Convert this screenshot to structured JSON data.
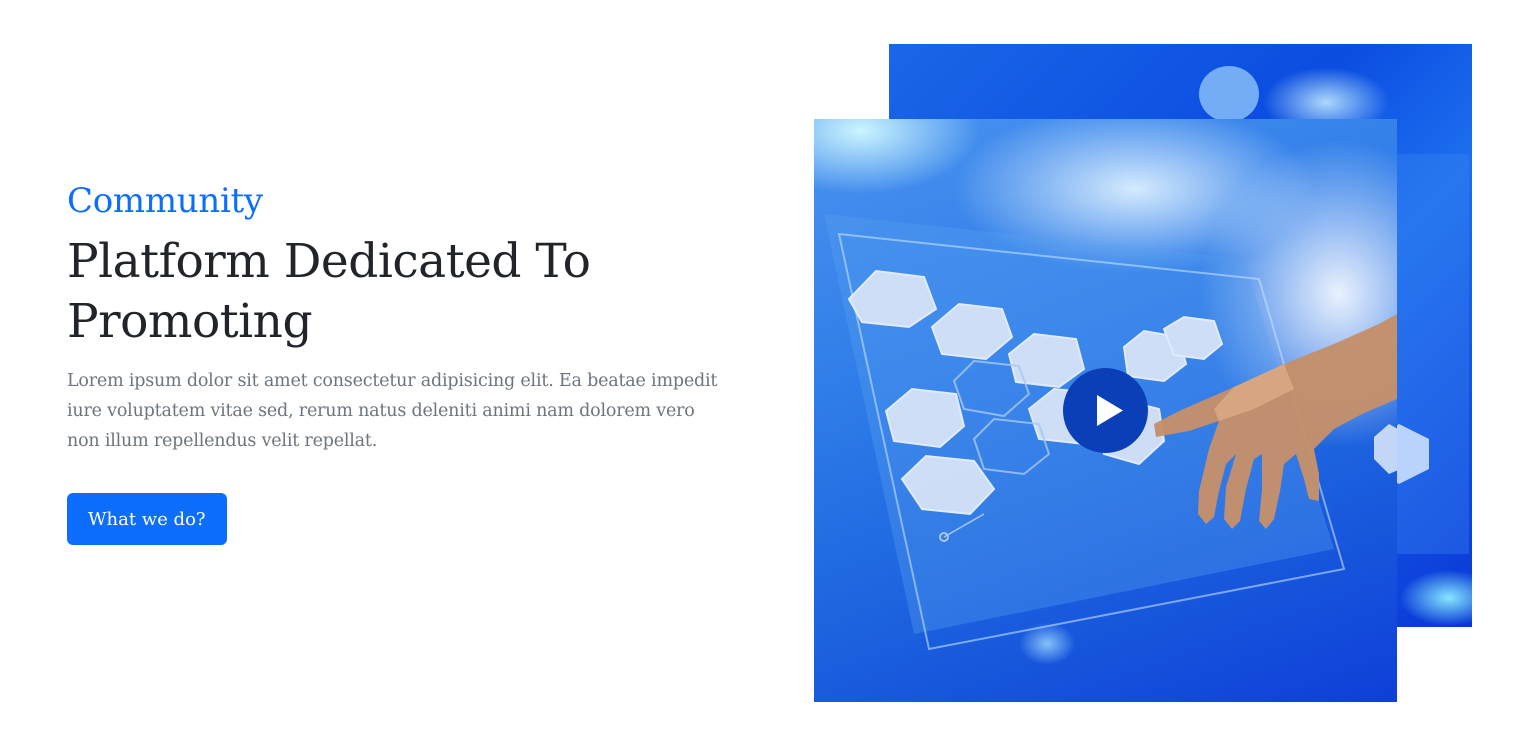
{
  "hero": {
    "eyebrow": "Community",
    "headline": "Platform Dedicated To Promoting",
    "description": "Lorem ipsum dolor sit amet consectetur adipisicing elit. Ea beatae impedit iure voluptatem vitae sed, rerum natus deleniti animi nam dolorem vero non illum repellendus velit repellat.",
    "cta_label": "What we do?"
  },
  "media": {
    "play_icon": "play-icon"
  },
  "colors": {
    "accent": "#0d6efd",
    "heading": "#212529",
    "body_text": "#6c757d",
    "play_button": "#0a3fb8"
  }
}
